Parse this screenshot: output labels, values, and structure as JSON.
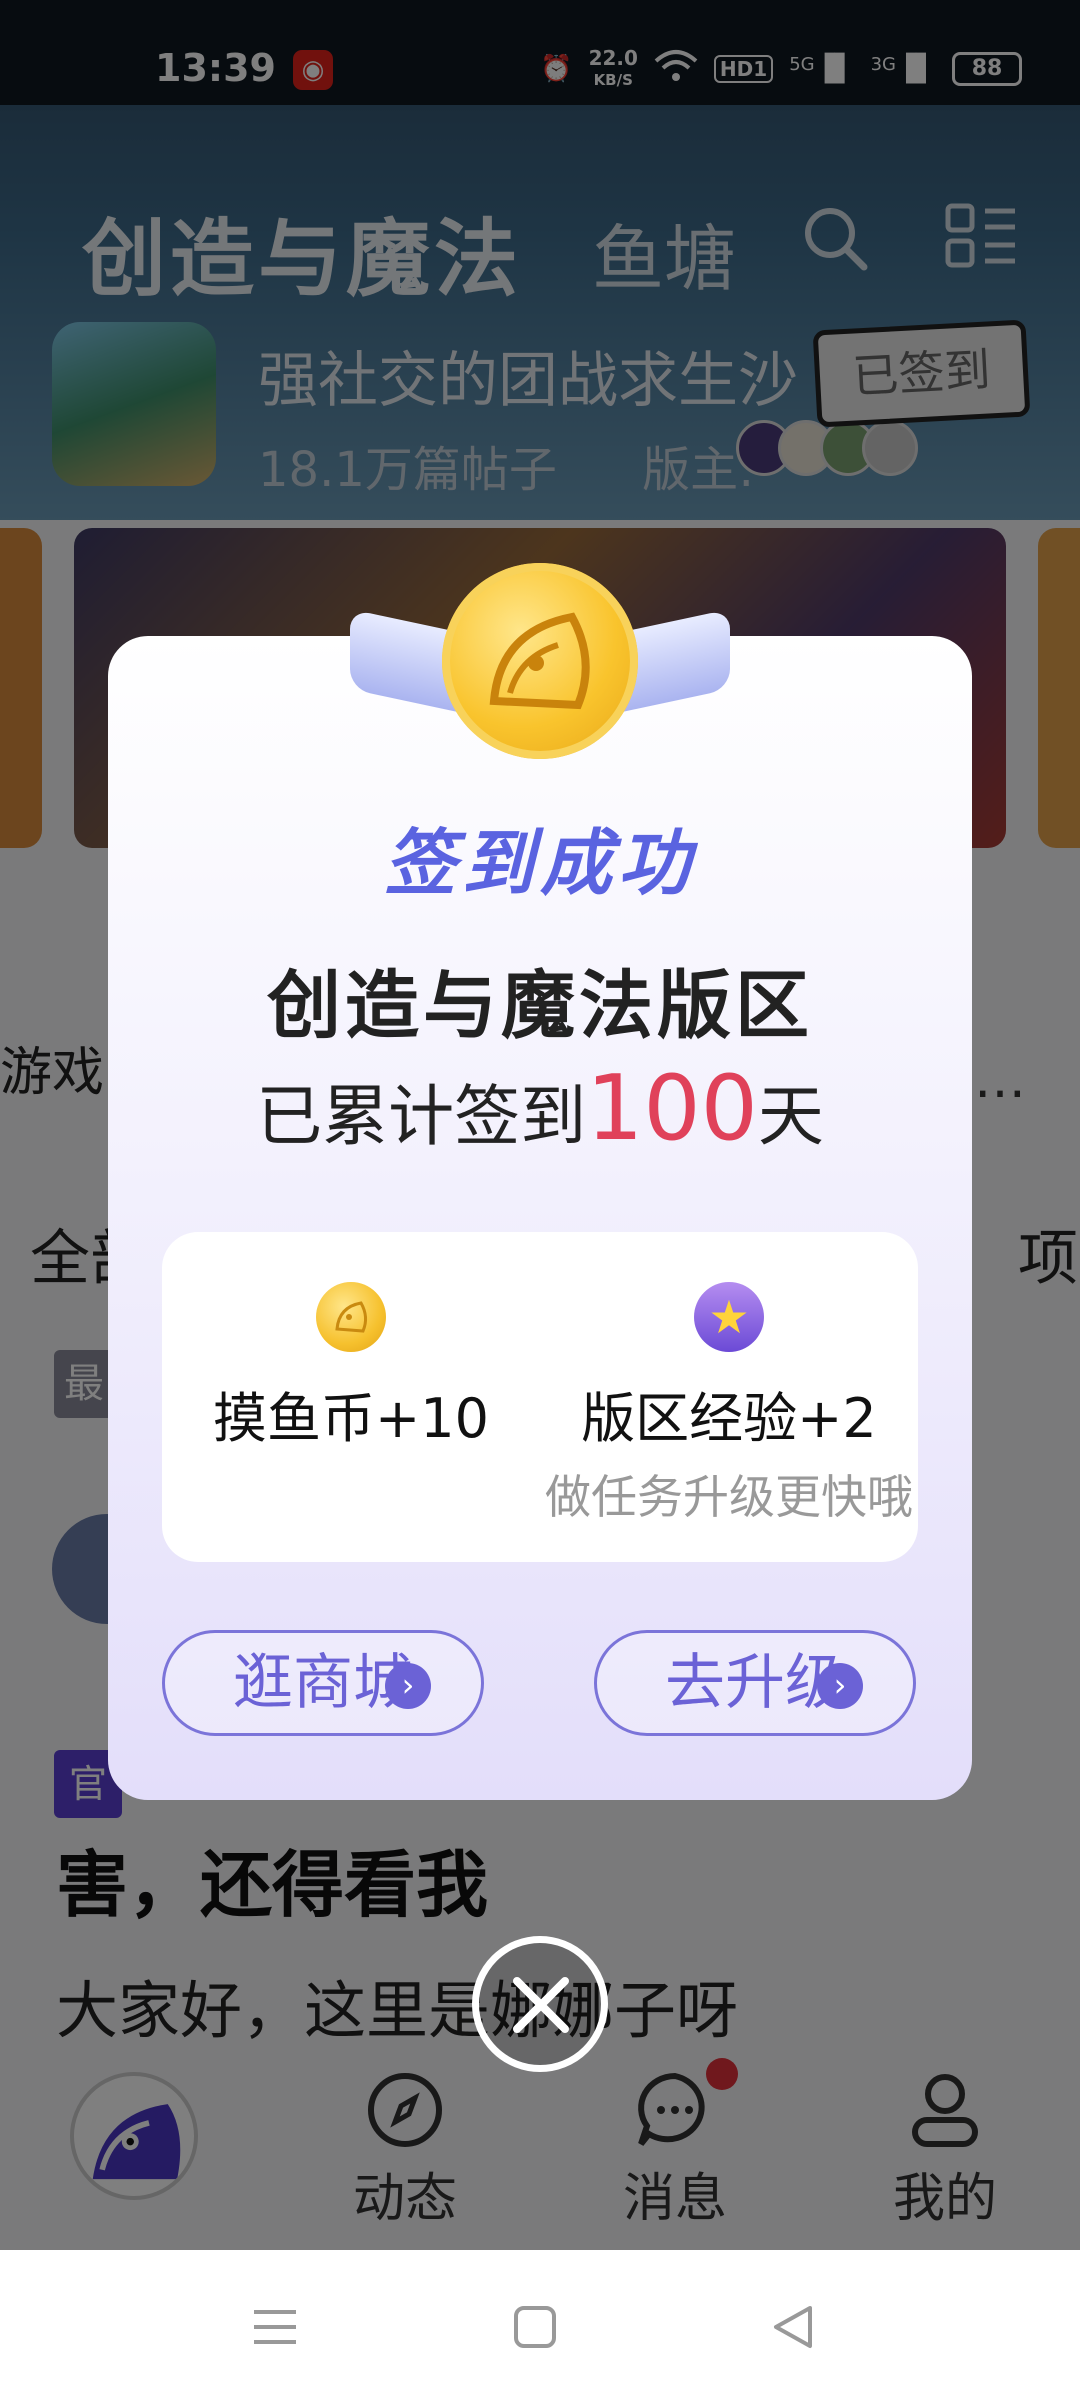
{
  "status_bar": {
    "time": "13:39",
    "net_speed_value": "22.0",
    "net_speed_unit": "KB/S",
    "hd_label": "HD1",
    "signal1": "5G",
    "signal2": "3G",
    "battery": "88"
  },
  "header": {
    "forum_title": "创造与魔法",
    "tab_fishpond": "鱼塘",
    "description": "强社交的团战求生沙",
    "post_count": "18.1万篇帖子",
    "moderator_label": "版主:",
    "signed_button": "已签到"
  },
  "entries": {
    "first_label": "游戏",
    "more": "…"
  },
  "feed": {
    "tab_left": "全部",
    "tab_right": "项",
    "tag_latest": "最",
    "tag_official": "官",
    "post_title": "害，还得看我",
    "post_body": "大家好，这里是娜娜子呀"
  },
  "bottom_nav": {
    "dynamic": "动态",
    "messages": "消息",
    "me": "我的"
  },
  "modal": {
    "title": "签到成功",
    "forum_name": "创造与魔法版区",
    "count_prefix": "已累计签到",
    "count_value": "100",
    "count_suffix": "天",
    "reward_coin": "摸鱼币+10",
    "reward_exp": "版区经验+2",
    "reward_hint": "做任务升级更快哦",
    "btn_shop": "逛商城",
    "btn_upgrade": "去升级"
  },
  "colors": {
    "accent_purple": "#6b62d6",
    "count_red": "#e0415a",
    "coin_gold": "#f9c42d"
  }
}
